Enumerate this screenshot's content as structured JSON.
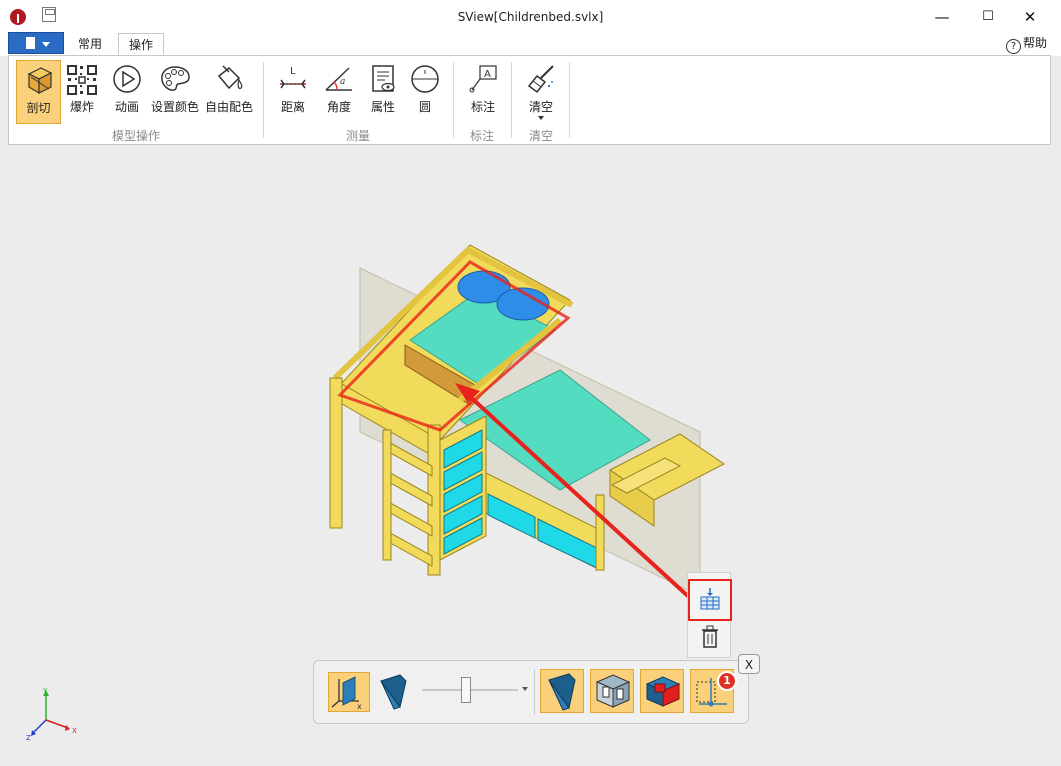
{
  "window": {
    "title": "SView[Childrenbed.svlx]",
    "minimize": "—",
    "maximize": "☐",
    "close": "✕"
  },
  "tabs": [
    {
      "label": "常用",
      "active": false
    },
    {
      "label": "操作",
      "active": true
    }
  ],
  "help": {
    "label": "帮助",
    "icon": "?"
  },
  "ribbon": {
    "groups": [
      {
        "label": "模型操作",
        "buttons": [
          {
            "label": "剖切",
            "icon": "section-cube-icon",
            "active": true
          },
          {
            "label": "爆炸",
            "icon": "explode-icon"
          },
          {
            "label": "动画",
            "icon": "play-icon"
          },
          {
            "label": "设置颜色",
            "icon": "palette-icon"
          },
          {
            "label": "自由配色",
            "icon": "paint-bucket-icon"
          }
        ]
      },
      {
        "label": "测量",
        "buttons": [
          {
            "label": "距离",
            "icon": "distance-icon"
          },
          {
            "label": "角度",
            "icon": "angle-icon"
          },
          {
            "label": "属性",
            "icon": "properties-icon"
          },
          {
            "label": "圆",
            "icon": "circle-icon"
          }
        ]
      },
      {
        "label": "标注",
        "buttons": [
          {
            "label": "标注",
            "icon": "annotation-icon"
          }
        ]
      },
      {
        "label": "清空",
        "buttons": [
          {
            "label": "清空",
            "icon": "broom-icon",
            "dropdown": true
          }
        ]
      }
    ]
  },
  "axis_triad": {
    "x": "X",
    "y": "Y",
    "z": "Z"
  },
  "section_toolbar": {
    "close_label": "X",
    "badge": "1",
    "buttons": [
      {
        "icon": "plane-axis-x-icon"
      },
      {
        "icon": "section-plane-icon"
      },
      {
        "icon": "section-plane-active-icon"
      },
      {
        "icon": "section-box-icon"
      },
      {
        "icon": "section-cap-icon"
      },
      {
        "icon": "section-list-icon"
      }
    ],
    "slider_position": 0.45
  },
  "colors": {
    "accent_orange": "#fbd07a",
    "bed_yellow": "#f2db5a",
    "mattress_cyan": "#54dcc0",
    "drawer_cyan": "#1fd8e8",
    "highlight_red": "#e8221c",
    "file_blue": "#2a6bc4"
  }
}
